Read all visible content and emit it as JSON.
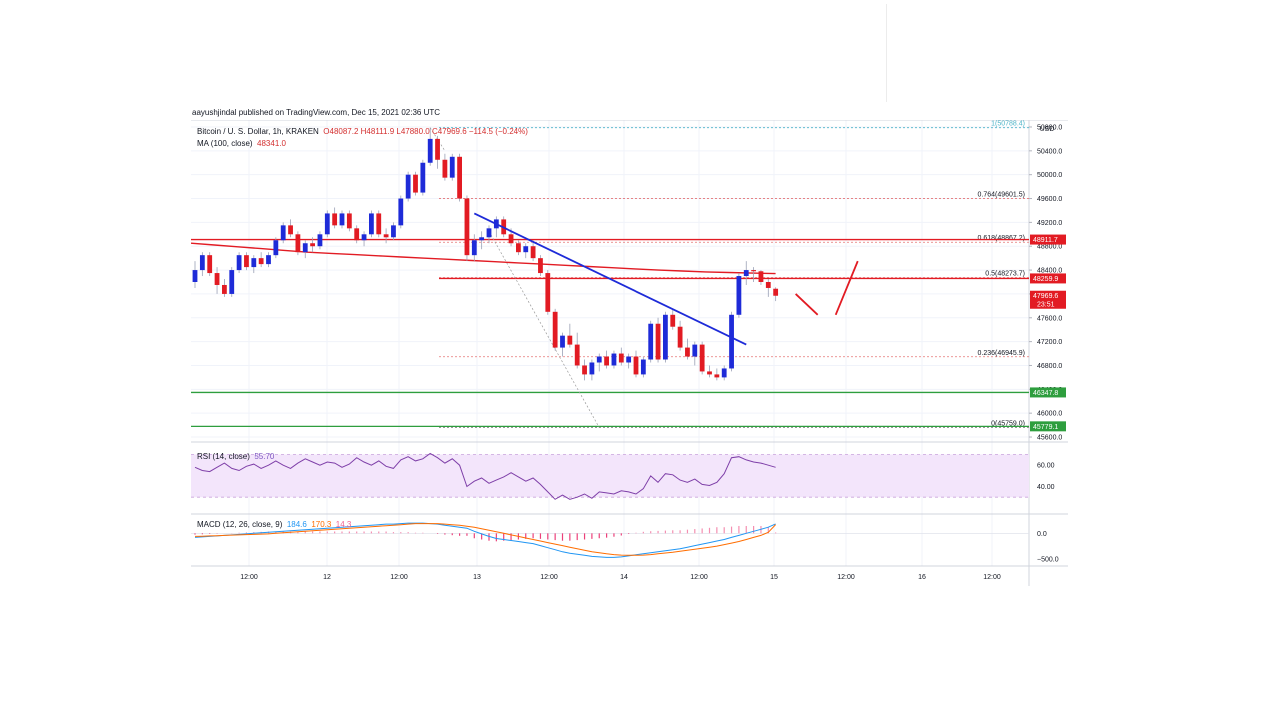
{
  "publisher_line": "aayushjindal published on TradingView.com, Dec 15, 2021 02:36 UTC",
  "header": {
    "symbol": "Bitcoin / U. S. Dollar, 1h, KRAKEN",
    "ohlc": "O48087.2  H48111.9  L47880.0  C47969.6  −114.5 (−0.24%)",
    "ma_label": "MA (100, close)",
    "ma_value": "48341.0"
  },
  "rsi": {
    "label": "RSI (14, close)",
    "value": "55.70",
    "ticks": [
      "60.00",
      "40.00"
    ]
  },
  "macd": {
    "label": "MACD (12, 26, close, 9)",
    "v1": "184.6",
    "v2": "170.3",
    "v3": "14.3",
    "ticks": [
      "0.0",
      "−500.0"
    ]
  },
  "currency": "USD",
  "colors": {
    "up": "#1e2bd8",
    "down": "#e21b23",
    "ma": "#e21b23",
    "trendline": "#1e2bd8",
    "support": "#2e9e3e",
    "rsi": "#7e3fa8",
    "macd": "#2196f3",
    "signal": "#ff6d00"
  },
  "chart_data": {
    "type": "candlestick",
    "price_axis": [
      "50800.0",
      "50400.0",
      "50000.0",
      "49600.0",
      "49200.0",
      "48800.0",
      "48400.0",
      "48000.0",
      "47600.0",
      "47200.0",
      "46800.0",
      "46400.0",
      "46000.0",
      "45600.0"
    ],
    "x_axis": [
      "12:00",
      "12",
      "12:00",
      "13",
      "12:00",
      "14",
      "12:00",
      "15",
      "12:00",
      "16",
      "12:00"
    ],
    "fib_levels": [
      {
        "label": "1(50788.4)",
        "price": 50788.4
      },
      {
        "label": "0.764(49601.5)",
        "price": 49601.5
      },
      {
        "label": "0.618(48867.2)",
        "price": 48867.2
      },
      {
        "label": "0.5(48273.7)",
        "price": 48273.7
      },
      {
        "label": "0.236(46945.9)",
        "price": 46945.9
      },
      {
        "label": "0(45759.0)",
        "price": 45759.0
      }
    ],
    "price_tags": [
      {
        "text": "48911.7",
        "price": 48911.7
      },
      {
        "text": "48259.9",
        "price": 48259.9
      },
      {
        "text": "47969.6",
        "price": 47969.6,
        "sub": "23:51"
      },
      {
        "text": "46347.8",
        "price": 46347.8,
        "green": true
      },
      {
        "text": "45779.1",
        "price": 45779.1,
        "green": true
      }
    ],
    "horizontal_lines": [
      {
        "price": 48911.7,
        "color": "red"
      },
      {
        "price": 48259.9,
        "color": "red"
      },
      {
        "price": 46347.8,
        "color": "green"
      },
      {
        "price": 45779.1,
        "color": "green"
      }
    ],
    "candles": [
      [
        48200,
        48550,
        48100,
        48400
      ],
      [
        48400,
        48700,
        48300,
        48650
      ],
      [
        48650,
        48700,
        48300,
        48350
      ],
      [
        48350,
        48450,
        48000,
        48150
      ],
      [
        48150,
        48250,
        47950,
        48000
      ],
      [
        48000,
        48450,
        47950,
        48400
      ],
      [
        48400,
        48700,
        48350,
        48650
      ],
      [
        48650,
        48700,
        48400,
        48450
      ],
      [
        48450,
        48650,
        48350,
        48600
      ],
      [
        48600,
        48700,
        48450,
        48500
      ],
      [
        48500,
        48700,
        48450,
        48650
      ],
      [
        48650,
        48950,
        48600,
        48900
      ],
      [
        48900,
        49200,
        48850,
        49150
      ],
      [
        49150,
        49250,
        48950,
        49000
      ],
      [
        49000,
        49050,
        48650,
        48700
      ],
      [
        48700,
        48900,
        48600,
        48850
      ],
      [
        48850,
        48950,
        48700,
        48800
      ],
      [
        48800,
        49050,
        48750,
        49000
      ],
      [
        49000,
        49400,
        48950,
        49350
      ],
      [
        49350,
        49450,
        49100,
        49150
      ],
      [
        49150,
        49400,
        49100,
        49350
      ],
      [
        49350,
        49400,
        49050,
        49100
      ],
      [
        49100,
        49150,
        48850,
        48900
      ],
      [
        48900,
        49050,
        48800,
        49000
      ],
      [
        49000,
        49400,
        48950,
        49350
      ],
      [
        49350,
        49400,
        48950,
        49000
      ],
      [
        49000,
        49100,
        48850,
        48950
      ],
      [
        48950,
        49200,
        48900,
        49150
      ],
      [
        49150,
        49650,
        49100,
        49600
      ],
      [
        49600,
        50050,
        49550,
        50000
      ],
      [
        50000,
        50050,
        49650,
        49700
      ],
      [
        49700,
        50250,
        49650,
        50200
      ],
      [
        50200,
        50788,
        50150,
        50600
      ],
      [
        50600,
        50650,
        50100,
        50250
      ],
      [
        50250,
        50350,
        49900,
        49950
      ],
      [
        49950,
        50350,
        49900,
        50300
      ],
      [
        50300,
        50350,
        49550,
        49600
      ],
      [
        49600,
        49650,
        48550,
        48650
      ],
      [
        48650,
        49000,
        48550,
        48900
      ],
      [
        48900,
        49050,
        48750,
        48950
      ],
      [
        48950,
        49150,
        48850,
        49100
      ],
      [
        49100,
        49300,
        48950,
        49250
      ],
      [
        49250,
        49300,
        48950,
        49000
      ],
      [
        49000,
        49100,
        48800,
        48850
      ],
      [
        48850,
        48900,
        48650,
        48700
      ],
      [
        48700,
        48850,
        48600,
        48800
      ],
      [
        48800,
        48900,
        48550,
        48600
      ],
      [
        48600,
        48650,
        48300,
        48350
      ],
      [
        48350,
        48400,
        47650,
        47700
      ],
      [
        47700,
        47750,
        47050,
        47100
      ],
      [
        47100,
        47350,
        46950,
        47300
      ],
      [
        47300,
        47500,
        47100,
        47150
      ],
      [
        47150,
        47350,
        46750,
        46800
      ],
      [
        46800,
        46900,
        46550,
        46650
      ],
      [
        46650,
        46900,
        46550,
        46850
      ],
      [
        46850,
        47000,
        46700,
        46950
      ],
      [
        46950,
        47050,
        46750,
        46800
      ],
      [
        46800,
        47050,
        46750,
        47000
      ],
      [
        47000,
        47100,
        46800,
        46850
      ],
      [
        46850,
        47000,
        46750,
        46950
      ],
      [
        46950,
        47050,
        46600,
        46650
      ],
      [
        46650,
        46950,
        46600,
        46900
      ],
      [
        46900,
        47550,
        46850,
        47500
      ],
      [
        47500,
        47600,
        46850,
        46900
      ],
      [
        46900,
        47700,
        46850,
        47650
      ],
      [
        47650,
        47750,
        47400,
        47450
      ],
      [
        47450,
        47550,
        47050,
        47100
      ],
      [
        47100,
        47250,
        46900,
        46950
      ],
      [
        46950,
        47200,
        46800,
        47150
      ],
      [
        47150,
        47200,
        46650,
        46700
      ],
      [
        46700,
        46800,
        46600,
        46650
      ],
      [
        46650,
        46750,
        46550,
        46600
      ],
      [
        46600,
        46800,
        46550,
        46750
      ],
      [
        46750,
        47700,
        46700,
        47650
      ],
      [
        47650,
        48350,
        47600,
        48300
      ],
      [
        48300,
        48550,
        48150,
        48400
      ],
      [
        48400,
        48450,
        48200,
        48380
      ],
      [
        48380,
        48400,
        48150,
        48200
      ],
      [
        48200,
        48250,
        47950,
        48100
      ],
      [
        48087.2,
        48111.9,
        47880,
        47969.6
      ]
    ],
    "ma100": [
      48850,
      48820,
      48790,
      48760,
      48730,
      48700,
      48680,
      48660,
      48640,
      48620,
      48600,
      48580,
      48560,
      48540,
      48520,
      48500,
      48480,
      48460,
      48440,
      48420,
      48400,
      48385,
      48370,
      48360,
      48350,
      48341
    ],
    "trendline": [
      {
        "i": 38,
        "price": 49350
      },
      {
        "i": 75,
        "price": 47150
      }
    ],
    "projection": [
      {
        "i": 79,
        "price": 48000
      },
      {
        "i": 82,
        "price": 47650
      },
      {
        "i": 85,
        "price": 48550
      }
    ],
    "rsi_series": [
      58,
      55,
      54,
      58,
      62,
      57,
      55,
      59,
      61,
      57,
      60,
      64,
      60,
      57,
      62,
      66,
      63,
      60,
      63,
      62,
      58,
      61,
      67,
      63,
      60,
      64,
      59,
      57,
      65,
      68,
      64,
      66,
      71,
      67,
      62,
      66,
      60,
      40,
      45,
      48,
      43,
      46,
      49,
      53,
      49,
      45,
      48,
      42,
      35,
      28,
      32,
      28,
      30,
      33,
      29,
      35,
      34,
      33,
      36,
      35,
      33,
      38,
      50,
      44,
      52,
      51,
      46,
      44,
      47,
      42,
      41,
      44,
      52,
      67,
      68,
      65,
      63,
      62,
      60,
      58
    ],
    "macd_line": [
      -80,
      -70,
      -60,
      -50,
      -40,
      -30,
      -20,
      -10,
      0,
      10,
      20,
      30,
      40,
      50,
      60,
      70,
      80,
      90,
      100,
      110,
      120,
      130,
      140,
      150,
      160,
      170,
      180,
      180,
      190,
      200,
      200,
      200,
      190,
      180,
      160,
      140,
      120,
      100,
      40,
      -10,
      -60,
      -100,
      -120,
      -140,
      -160,
      -180,
      -200,
      -240,
      -280,
      -320,
      -360,
      -390,
      -410,
      -430,
      -450,
      -460,
      -470,
      -470,
      -460,
      -440,
      -420,
      -400,
      -380,
      -360,
      -340,
      -320,
      -300,
      -270,
      -240,
      -210,
      -180,
      -150,
      -120,
      -80,
      -40,
      0,
      40,
      80,
      120,
      184.6
    ],
    "signal_line": [
      -60,
      -55,
      -50,
      -45,
      -40,
      -35,
      -30,
      -25,
      -20,
      -15,
      -10,
      0,
      10,
      20,
      30,
      40,
      50,
      60,
      70,
      80,
      90,
      100,
      110,
      120,
      130,
      140,
      150,
      160,
      170,
      180,
      190,
      190,
      190,
      190,
      180,
      170,
      160,
      140,
      120,
      90,
      60,
      30,
      0,
      -30,
      -60,
      -90,
      -120,
      -150,
      -180,
      -210,
      -240,
      -270,
      -300,
      -330,
      -360,
      -380,
      -400,
      -415,
      -425,
      -430,
      -430,
      -425,
      -415,
      -400,
      -385,
      -370,
      -350,
      -330,
      -310,
      -290,
      -270,
      -250,
      -220,
      -190,
      -160,
      -120,
      -80,
      -40,
      20,
      170.3
    ]
  }
}
